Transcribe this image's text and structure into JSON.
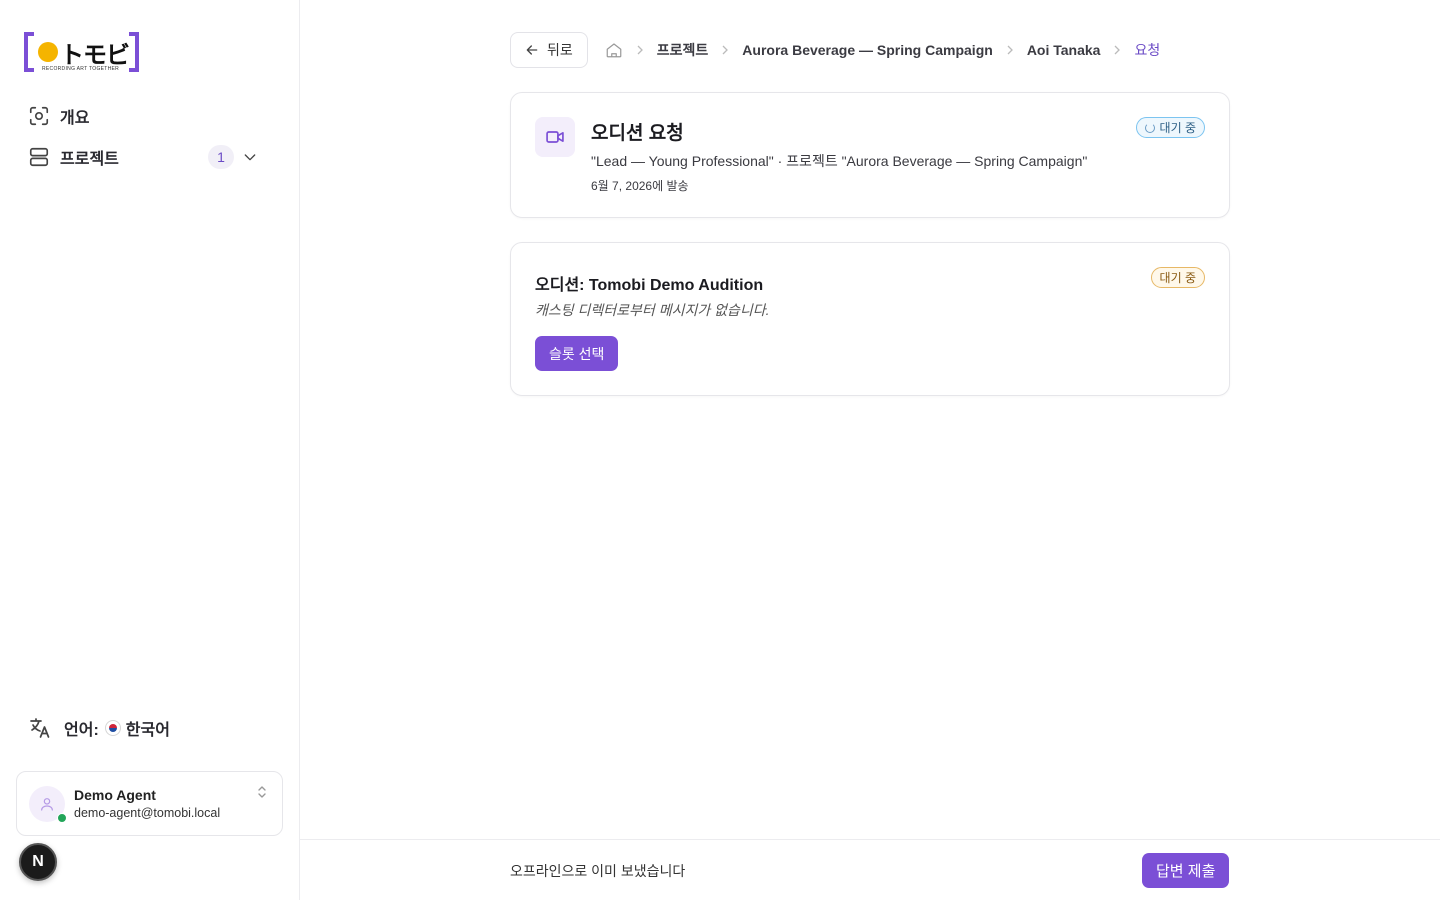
{
  "brand": {
    "logo_text": "トモビ",
    "tagline": "RECORDING ART TOGETHER",
    "accent_color": "#7b4fd6",
    "dot_color": "#f5b400"
  },
  "sidebar": {
    "items": [
      {
        "label": "개요",
        "icon": "overview-scan-icon"
      },
      {
        "label": "프로젝트",
        "icon": "projects-icon",
        "count": "1",
        "expand_icon": "chevron-down-icon"
      }
    ],
    "language": {
      "prefix": "언어:",
      "value": "한국어",
      "icon": "translate-icon",
      "flag": "korea-flag-icon"
    },
    "user": {
      "name": "Demo Agent",
      "email": "demo-agent@tomobi.local",
      "status_color": "#22a559"
    },
    "dev_badge": "N"
  },
  "breadcrumb": {
    "back_label": "뒤로",
    "items": [
      "프로젝트",
      "Aurora Beverage — Spring Campaign",
      "Aoi Tanaka"
    ],
    "current": "요청"
  },
  "request_card": {
    "title": "오디션 요청",
    "subtitle": "\"Lead — Young Professional\" · 프로젝트 \"Aurora Beverage — Spring Campaign\"",
    "date": "6월 7, 2026에 발송",
    "status": "대기 중",
    "icon": "video-camera-icon"
  },
  "audition_card": {
    "title": "오디션: Tomobi Demo Audition",
    "message": "캐스팅 디렉터로부터 메시지가 없습니다.",
    "status": "대기 중",
    "action_label": "슬롯 선택"
  },
  "footer": {
    "note": "오프라인으로 이미 보냈습니다",
    "submit_label": "답변 제출"
  }
}
